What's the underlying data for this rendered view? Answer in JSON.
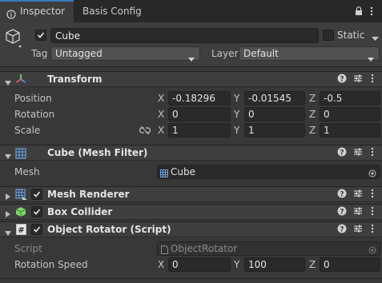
{
  "tabs": [
    {
      "label": "Inspector",
      "icon": "info-icon"
    },
    {
      "label": "Basis Config"
    }
  ],
  "gameobject": {
    "name": "Cube",
    "active": true,
    "static_label": "Static",
    "static": false,
    "tag_label": "Tag",
    "tag_value": "Untagged",
    "layer_label": "Layer",
    "layer_value": "Default"
  },
  "transform": {
    "title": "Transform",
    "position_label": "Position",
    "rotation_label": "Rotation",
    "scale_label": "Scale",
    "axes": [
      "X",
      "Y",
      "Z"
    ],
    "position": [
      "-0.18296",
      "-0.01545",
      "-0.5"
    ],
    "rotation": [
      "0",
      "0",
      "0"
    ],
    "scale": [
      "1",
      "1",
      "1"
    ]
  },
  "mesh_filter": {
    "title": "Cube (Mesh Filter)",
    "mesh_label": "Mesh",
    "mesh_value": "Cube"
  },
  "mesh_renderer": {
    "title": "Mesh Renderer",
    "enabled": true
  },
  "box_collider": {
    "title": "Box Collider",
    "enabled": true
  },
  "object_rotator": {
    "title": "Object Rotator (Script)",
    "enabled": true,
    "script_label": "Script",
    "script_value": "ObjectRotator",
    "speed_label": "Rotation Speed",
    "speed": [
      "0",
      "100",
      "0"
    ]
  },
  "colors": {
    "accent": "#3a79bb",
    "background": "#383838",
    "header": "#3e3e3e",
    "field": "#2a2a2a"
  }
}
